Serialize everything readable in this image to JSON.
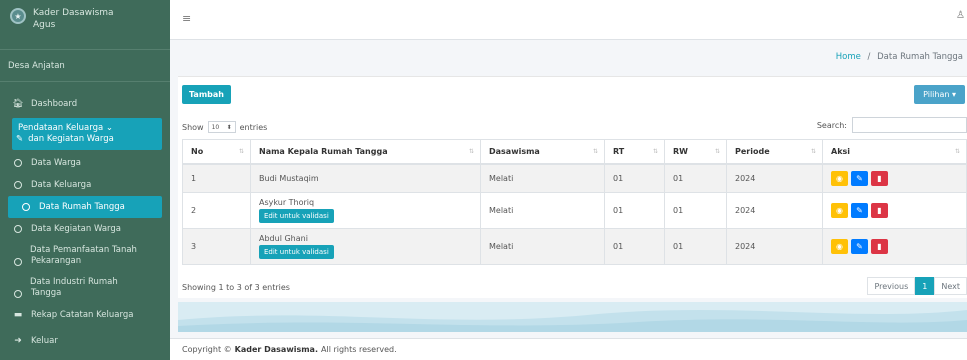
{
  "sidebar": {
    "brand_line1": "Kader Dasawisma",
    "brand_line2": "Agus",
    "desa": "Desa Anjatan",
    "dashboard": "Dashboard",
    "group_line1": "Pendataan Keluarga",
    "group_line2": "dan Kegiatan Warga",
    "items": [
      {
        "label": "Data Warga"
      },
      {
        "label": "Data Keluarga"
      },
      {
        "label": "Data Rumah Tangga"
      },
      {
        "label": "Data Kegiatan Warga"
      },
      {
        "label_line1": "Data Pemanfaatan Tanah",
        "label_line2": "Pekarangan"
      },
      {
        "label_line1": "Data Industri Rumah",
        "label_line2": "Tangga"
      }
    ],
    "rekap": "Rekap Catatan Keluarga",
    "keluar": "Keluar"
  },
  "breadcrumb": {
    "home": "Home",
    "sep": "/",
    "current": "Data Rumah Tangga"
  },
  "toolbar": {
    "tambah": "Tambah",
    "pilihan": "Pilihan"
  },
  "table_controls": {
    "show_prefix": "Show",
    "entries_value": "10",
    "show_suffix": "entries",
    "search_label": "Search:"
  },
  "table": {
    "headers": [
      "No",
      "Nama Kepala Rumah Tangga",
      "Dasawisma",
      "RT",
      "RW",
      "Periode",
      "Aksi"
    ],
    "rows": [
      {
        "no": "1",
        "nama": "Budi Mustaqim",
        "dasawisma": "Melati",
        "rt": "01",
        "rw": "01",
        "periode": "2024"
      },
      {
        "no": "2",
        "nama": "Asykur Thoriq",
        "badge": "Edit untuk validasi",
        "dasawisma": "Melati",
        "rt": "01",
        "rw": "01",
        "periode": "2024"
      },
      {
        "no": "3",
        "nama": "Abdul Ghani",
        "badge": "Edit untuk validasi",
        "dasawisma": "Melati",
        "rt": "01",
        "rw": "01",
        "periode": "2024"
      }
    ]
  },
  "pagination": {
    "info": "Showing 1 to 3 of 3 entries",
    "previous": "Previous",
    "current": "1",
    "next": "Next"
  },
  "footer": {
    "prefix": "Copyright © ",
    "brand": "Kader Dasawisma.",
    "suffix": " All rights reserved."
  },
  "colors": {
    "sidebar_bg": "#3f6b5a",
    "accent": "#17a2b8",
    "view_btn": "#ffc107",
    "edit_btn": "#007bff",
    "delete_btn": "#dc3545"
  }
}
